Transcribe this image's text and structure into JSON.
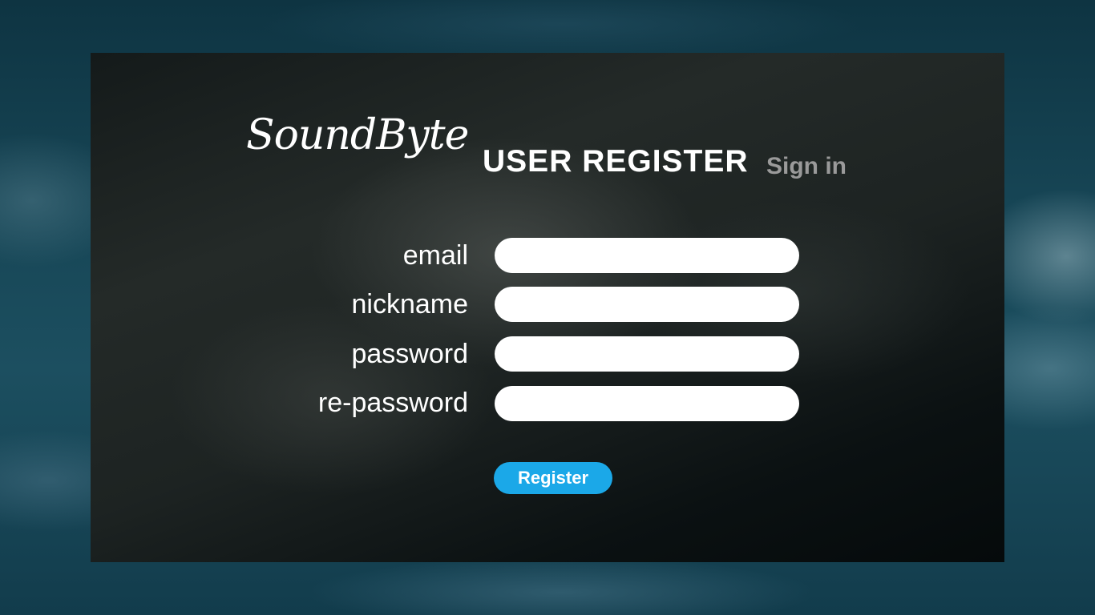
{
  "app": {
    "logo_text": "SoundByte"
  },
  "header": {
    "title": "USER REGISTER",
    "sign_in_link": "Sign in"
  },
  "form": {
    "fields": [
      {
        "label": "email",
        "value": "",
        "type": "text"
      },
      {
        "label": "nickname",
        "value": "",
        "type": "text"
      },
      {
        "label": "password",
        "value": "",
        "type": "password"
      },
      {
        "label": "re-password",
        "value": "",
        "type": "password"
      }
    ],
    "submit_label": "Register"
  },
  "colors": {
    "button_bg": "#1ba8e8",
    "sign_in_text": "#9a9a9a",
    "panel_bg": "#1d2322"
  }
}
